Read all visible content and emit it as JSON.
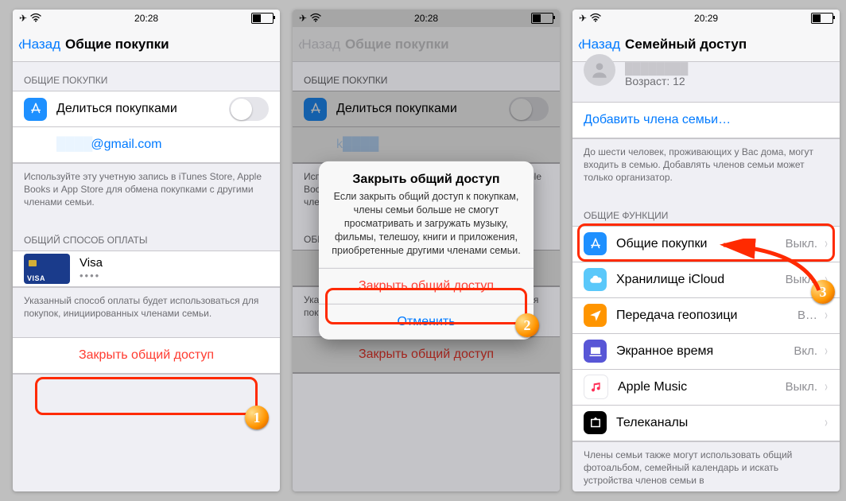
{
  "status": {
    "time1": "20:28",
    "time2": "20:29"
  },
  "nav": {
    "back": "Назад",
    "title_sharing": "Общие покупки",
    "title_family": "Сeмейный доступ"
  },
  "p1": {
    "section_share": "ОБЩИЕ ПОКУПКИ",
    "share_label": "Делиться покупками",
    "email": "@gmail.com",
    "footer1": "Используйте эту учетную запись в iTunes Store, Apple Books и App Store для обмена покупками с другими членами семьи.",
    "section_pay": "ОБЩИЙ СПОСОБ ОПЛАТЫ",
    "card_brand": "Visa",
    "card_dots": "•••• ",
    "card_badge": "VISA",
    "footer2": "Указанный способ оплаты будет использоваться для покупок, инициированных членами семьи.",
    "close_btn": "Закрыть общий доступ"
  },
  "p2": {
    "alert_title": "Закрыть общий доступ",
    "alert_msg": "Если закрыть общий доступ к покупкам, члены семьи больше не смогут просматривать и загружать музыку, фильмы, телешоу, книги и приложения, приобретенные другими членами семьи.",
    "alert_confirm": "Закрыть общий доступ",
    "alert_cancel": "Отменить"
  },
  "p3": {
    "member_age": "Возраст: 12",
    "add_member": "Добавить члена семьи…",
    "footer_members": "До шести человек, проживающих у Вас дома, могут входить в семью. Добавлять членов семьи может только организатор.",
    "section_feat": "ОБЩИЕ ФУНКЦИИ",
    "rows": [
      {
        "icon": "appstore",
        "label": "Общие покупки",
        "value": "Выкл."
      },
      {
        "icon": "icloud",
        "label": "Хранилище iCloud",
        "value": "Выкл."
      },
      {
        "icon": "location",
        "label": "Передача геопозици",
        "value": "В…"
      },
      {
        "icon": "screentime",
        "label": "Экранное время",
        "value": "Вкл."
      },
      {
        "icon": "music",
        "label": "Apple Music",
        "value": "Выкл."
      },
      {
        "icon": "tv",
        "label": "Телеканалы",
        "value": ""
      }
    ],
    "footer_bottom": "Члены семьи также могут использовать общий фотоальбом, семейный календарь и искать устройства членов семьи в"
  },
  "badges": {
    "b1": "1",
    "b2": "2",
    "b3": "3"
  }
}
